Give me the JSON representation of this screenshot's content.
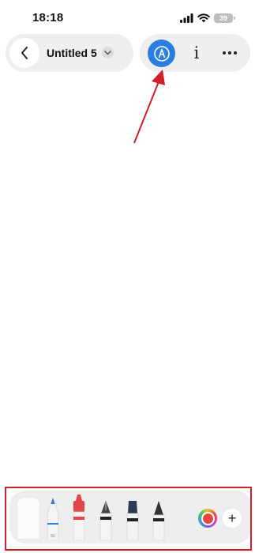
{
  "status_bar": {
    "time": "18:18",
    "battery": "39"
  },
  "header": {
    "back_icon": "chevron-left-icon",
    "title": "Untitled 5",
    "title_menu_icon": "chevron-down-icon",
    "markup_icon": "pen-tip-icon",
    "info_icon": "info-icon",
    "info_label": "i",
    "more_icon": "ellipsis-icon"
  },
  "annotation": {
    "arrow_color": "#d21f26",
    "highlight_color": "#d21f26"
  },
  "tool_palette": {
    "tools": [
      "eraser",
      "pencil",
      "crayon",
      "fountain-pen",
      "calligraphy-pen",
      "marker"
    ],
    "pencil_label": "50",
    "selected_color": "#e8453c",
    "add_label": "+"
  },
  "colors": {
    "accent": "#2a7de1",
    "pill_background": "#efefef"
  }
}
